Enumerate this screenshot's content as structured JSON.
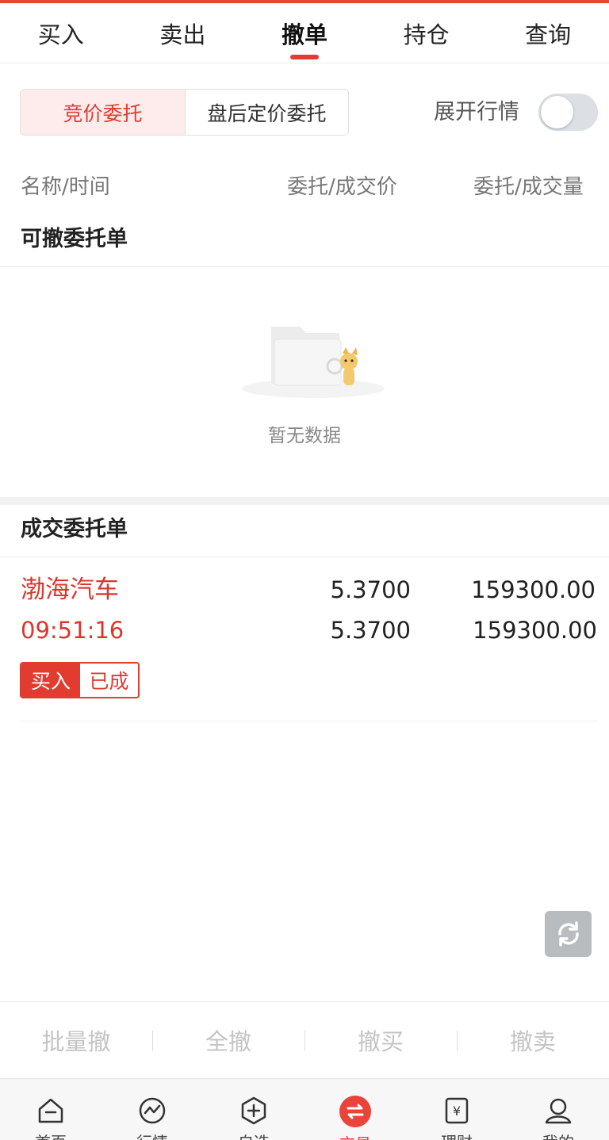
{
  "tabs": [
    {
      "label": "买入"
    },
    {
      "label": "卖出"
    },
    {
      "label": "撤单",
      "active": true
    },
    {
      "label": "持仓"
    },
    {
      "label": "查询"
    }
  ],
  "segment": {
    "option_a": "竞价委托",
    "option_b": "盘后定价委托",
    "selected": "竞价委托"
  },
  "expand": {
    "label": "展开行情",
    "on": false
  },
  "columns": {
    "name_time": "名称/时间",
    "price": "委托/成交价",
    "volume": "委托/成交量"
  },
  "cancelable": {
    "title": "可撤委托单",
    "empty_text": "暂无数据"
  },
  "filled": {
    "title": "成交委托单",
    "orders": [
      {
        "name": "渤海汽车",
        "time": "09:51:16",
        "order_price": "5.3700",
        "deal_price": "5.3700",
        "order_qty": "159300.00",
        "deal_qty": "159300.00",
        "side": "买入",
        "status": "已成"
      }
    ]
  },
  "actions": [
    {
      "label": "批量撤"
    },
    {
      "label": "全撤"
    },
    {
      "label": "撤买"
    },
    {
      "label": "撤卖"
    }
  ],
  "nav": [
    {
      "label": "首页",
      "icon": "home-icon"
    },
    {
      "label": "行情",
      "icon": "market-icon"
    },
    {
      "label": "自选",
      "icon": "watchlist-icon"
    },
    {
      "label": "交易",
      "icon": "trade-icon",
      "active": true
    },
    {
      "label": "理财",
      "icon": "finance-icon"
    },
    {
      "label": "我的",
      "icon": "profile-icon"
    }
  ],
  "colors": {
    "accent": "#e23b30",
    "muted": "#c4c4c4"
  }
}
